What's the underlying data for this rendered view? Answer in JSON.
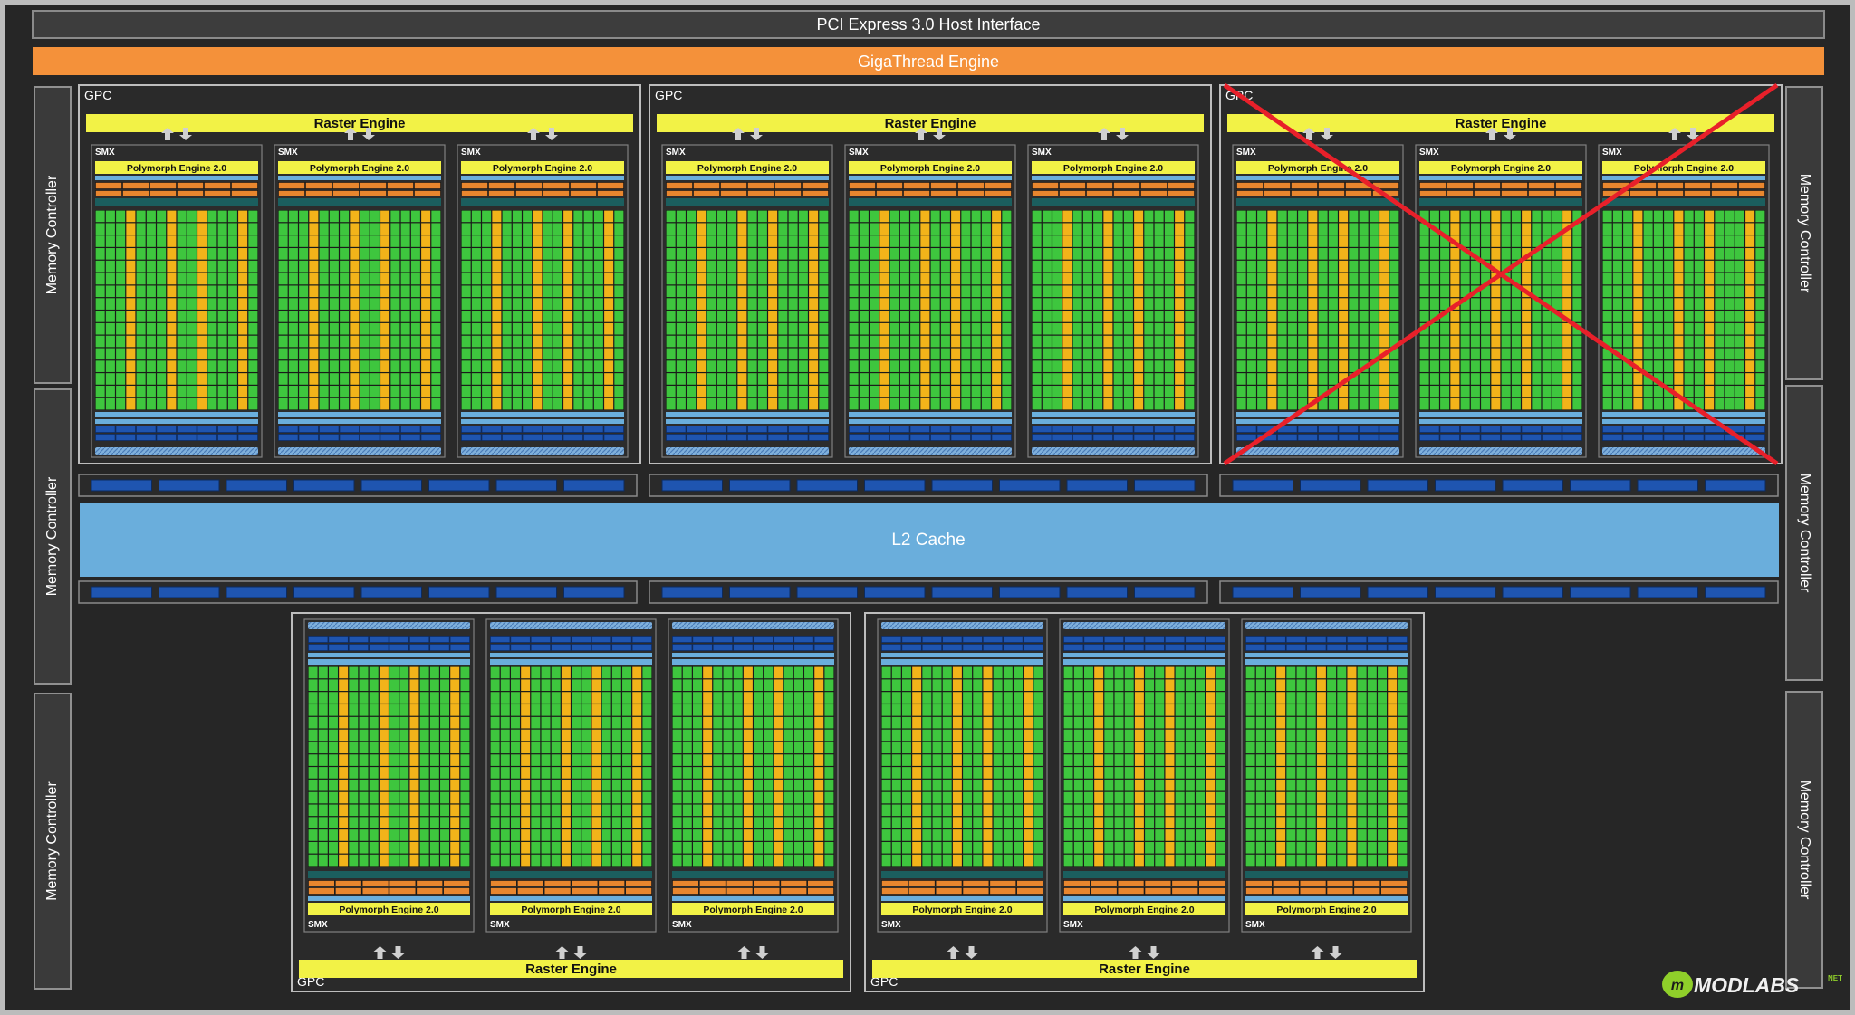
{
  "pcie": {
    "label": "PCI Express 3.0 Host Interface"
  },
  "gigathread": {
    "label": "GigaThread Engine"
  },
  "memory_controller": {
    "label": "Memory Controller"
  },
  "l2": {
    "label": "L2 Cache"
  },
  "gpc": {
    "label": "GPC",
    "raster_label": "Raster Engine"
  },
  "smx": {
    "label": "SMX",
    "polymorph_label": "Polymorph Engine 2.0"
  },
  "watermark": {
    "text": "MODLABS",
    "suffix": "NET"
  },
  "colors": {
    "background": "#262626",
    "gigathread": "#f4913a",
    "raster": "#f2f246",
    "core": "#3ec63e",
    "special_unit": "#f2b31a",
    "l2": "#6aaedc",
    "memory_bar": "#1f55b0",
    "cross": "#e8202a"
  }
}
